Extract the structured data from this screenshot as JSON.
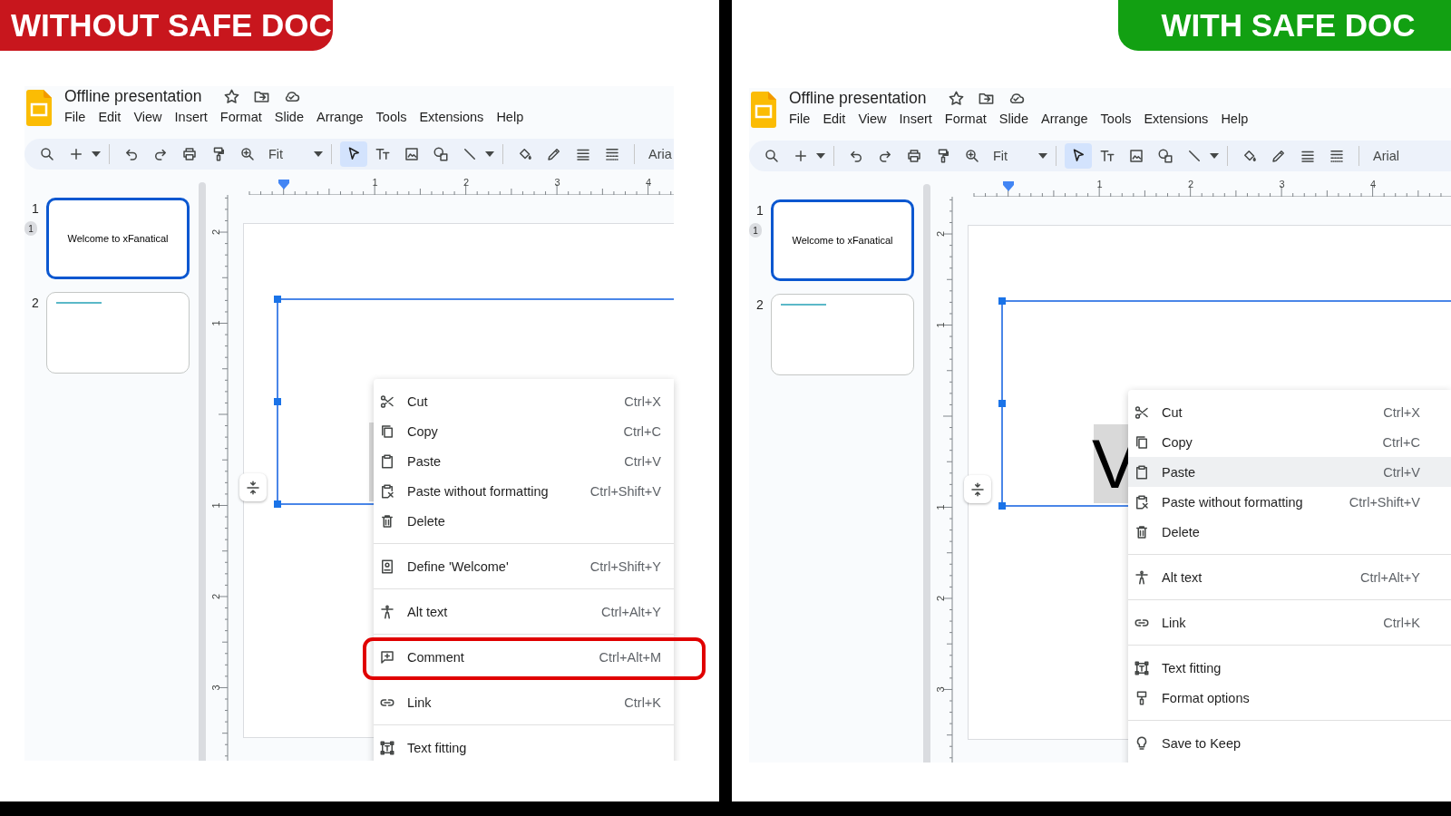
{
  "panels": [
    {
      "badge": {
        "text": "WITHOUT SAFE DOC",
        "color": "#c8161d"
      },
      "title": "Offline presentation",
      "menu": [
        "File",
        "Edit",
        "View",
        "Insert",
        "Format",
        "Slide",
        "Arrange",
        "Tools",
        "Extensions",
        "Help"
      ],
      "toolbar": {
        "zoom": "Fit",
        "font": "Aria"
      },
      "slides": [
        {
          "number": "1",
          "selected": true,
          "badge": "1",
          "title": "Welcome to xFanatical"
        },
        {
          "number": "2",
          "selected": false
        }
      ],
      "ruler": {
        "horizontal": [
          "1",
          "2",
          "3",
          "4"
        ],
        "vertical": [
          "2",
          "1",
          "1",
          "2",
          "3"
        ]
      },
      "context_menu": [
        {
          "items": [
            {
              "kind": "cut",
              "label": "Cut",
              "shortcut": "Ctrl+X",
              "selected": false,
              "highlighted": false
            },
            {
              "kind": "copy",
              "label": "Copy",
              "shortcut": "Ctrl+C",
              "selected": false,
              "highlighted": false
            },
            {
              "kind": "paste",
              "label": "Paste",
              "shortcut": "Ctrl+V",
              "selected": false,
              "highlighted": false
            },
            {
              "kind": "paste-plain",
              "label": "Paste without formatting",
              "shortcut": "Ctrl+Shift+V",
              "selected": false,
              "highlighted": false
            },
            {
              "kind": "delete",
              "label": "Delete",
              "selected": false,
              "highlighted": false
            }
          ]
        },
        {
          "items": [
            {
              "kind": "define",
              "label": "Define 'Welcome'",
              "shortcut": "Ctrl+Shift+Y",
              "selected": false,
              "highlighted": false
            }
          ]
        },
        {
          "items": [
            {
              "kind": "alt-text",
              "label": "Alt text",
              "shortcut": "Ctrl+Alt+Y",
              "selected": false,
              "highlighted": false
            }
          ]
        },
        {
          "items": [
            {
              "kind": "comment",
              "label": "Comment",
              "shortcut": "Ctrl+Alt+M",
              "selected": false,
              "highlighted": true
            }
          ]
        },
        {
          "items": [
            {
              "kind": "link",
              "label": "Link",
              "shortcut": "Ctrl+K",
              "selected": false,
              "highlighted": false
            }
          ]
        },
        {
          "items": [
            {
              "kind": "text-fitting",
              "label": "Text fitting",
              "selected": false,
              "highlighted": false
            }
          ]
        }
      ]
    },
    {
      "badge": {
        "text": "WITH SAFE DOC",
        "color": "#12a012"
      },
      "title": "Offline presentation",
      "menu": [
        "File",
        "Edit",
        "View",
        "Insert",
        "Format",
        "Slide",
        "Arrange",
        "Tools",
        "Extensions",
        "Help"
      ],
      "toolbar": {
        "zoom": "Fit",
        "font": "Arial"
      },
      "slides": [
        {
          "number": "1",
          "selected": true,
          "badge": "1",
          "title": "Welcome to xFanatical"
        },
        {
          "number": "2",
          "selected": false
        }
      ],
      "ruler": {
        "horizontal": [
          "1",
          "2",
          "3",
          "4"
        ],
        "vertical": [
          "2",
          "1",
          "1",
          "2",
          "3"
        ]
      },
      "slide_text": "V",
      "context_menu": [
        {
          "items": [
            {
              "kind": "cut",
              "label": "Cut",
              "shortcut": "Ctrl+X",
              "selected": false,
              "highlighted": false
            },
            {
              "kind": "copy",
              "label": "Copy",
              "shortcut": "Ctrl+C",
              "selected": false,
              "highlighted": false
            },
            {
              "kind": "paste",
              "label": "Paste",
              "shortcut": "Ctrl+V",
              "selected": true,
              "highlighted": false
            },
            {
              "kind": "paste-plain",
              "label": "Paste without formatting",
              "shortcut": "Ctrl+Shift+V",
              "selected": false,
              "highlighted": false
            },
            {
              "kind": "delete",
              "label": "Delete",
              "selected": false,
              "highlighted": false
            }
          ]
        },
        {
          "items": [
            {
              "kind": "alt-text",
              "label": "Alt text",
              "shortcut": "Ctrl+Alt+Y",
              "selected": false,
              "highlighted": false
            }
          ]
        },
        {
          "items": [
            {
              "kind": "link",
              "label": "Link",
              "shortcut": "Ctrl+K",
              "selected": false,
              "highlighted": false
            }
          ]
        },
        {
          "items": [
            {
              "kind": "text-fitting",
              "label": "Text fitting",
              "selected": false,
              "highlighted": false
            },
            {
              "kind": "format-options",
              "label": "Format options",
              "selected": false,
              "highlighted": false
            }
          ]
        },
        {
          "items": [
            {
              "kind": "save-keep",
              "label": "Save to Keep",
              "selected": false,
              "highlighted": false
            }
          ]
        }
      ]
    }
  ]
}
